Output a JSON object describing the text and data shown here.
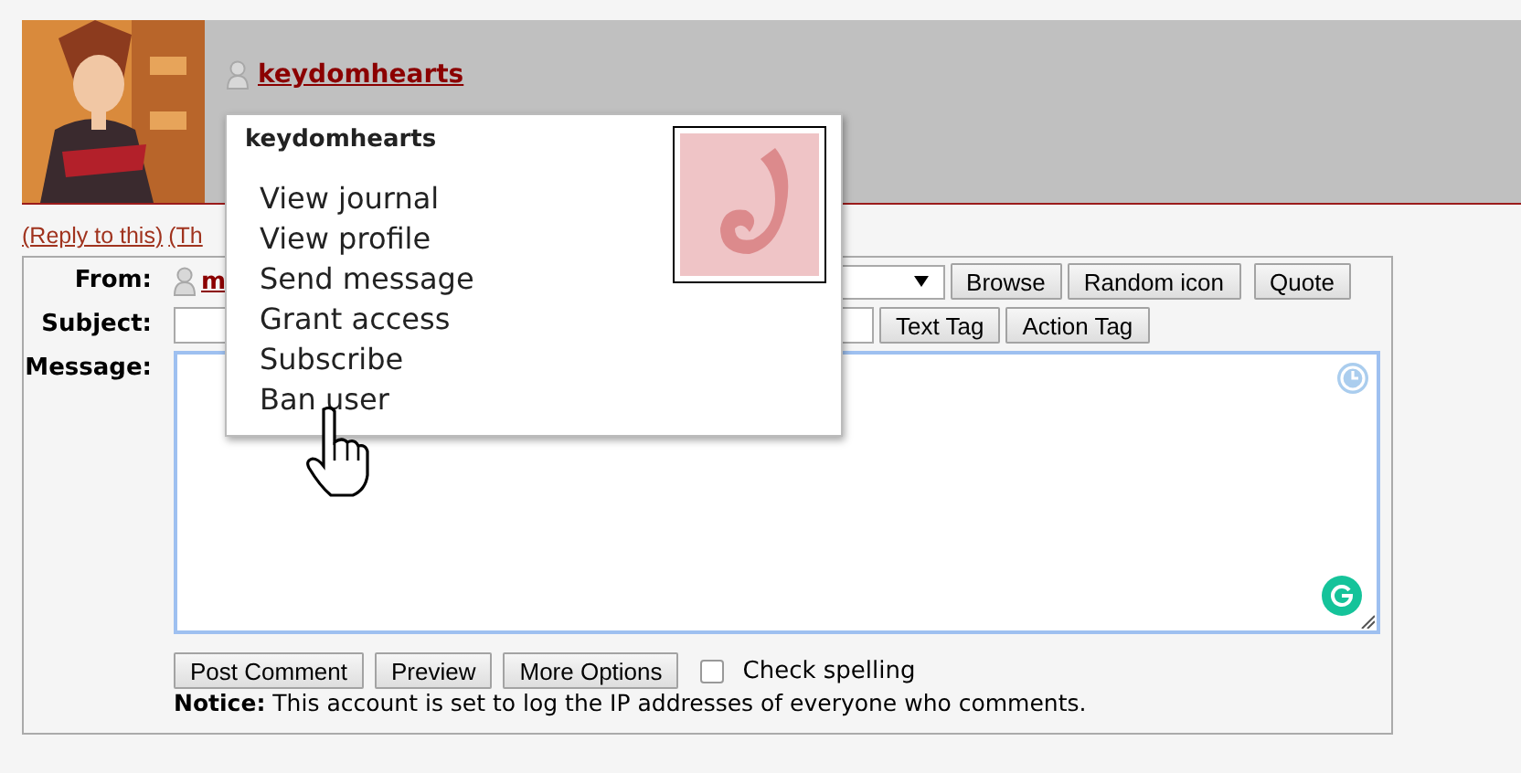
{
  "comment": {
    "username": "keydomhearts"
  },
  "actions": [
    {
      "label": "(Reply to this)"
    },
    {
      "label": "(Th"
    }
  ],
  "popup": {
    "title": "keydomhearts",
    "items": [
      {
        "label": "View journal"
      },
      {
        "label": "View profile"
      },
      {
        "label": "Send message"
      },
      {
        "label": "Grant access"
      },
      {
        "label": "Subscribe"
      },
      {
        "label": "Ban user"
      }
    ]
  },
  "form": {
    "from_label": "From:",
    "from_user": "m",
    "icon_buttons": [
      "Browse",
      "Random icon",
      "Quote"
    ],
    "subject_label": "Subject:",
    "tag_buttons": [
      "Text Tag",
      "Action Tag"
    ],
    "message_label": "Message:",
    "buttons": [
      "Post Comment",
      "Preview",
      "More Options"
    ],
    "spellcheck": {
      "label": "Check spelling",
      "checked": false
    },
    "notice": "**Notice:** This account is set to log the IP addresses of everyone who comments."
  }
}
